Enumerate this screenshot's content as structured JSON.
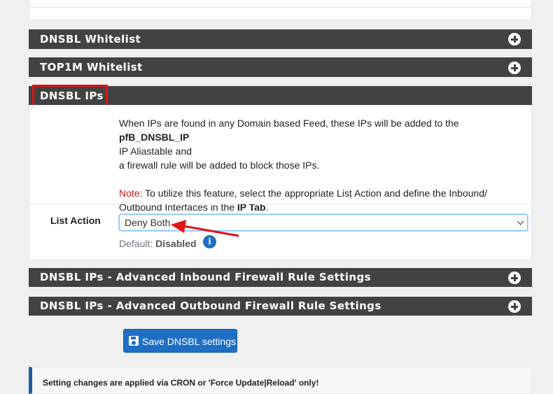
{
  "panels": {
    "dnsbl_whitelist": "DNSBL Whitelist",
    "top1m_whitelist": "TOP1M Whitelist",
    "dnsbl_ips": "DNSBL IPs",
    "adv_inbound": "DNSBL IPs - Advanced Inbound Firewall Rule Settings",
    "adv_outbound": "DNSBL IPs - Advanced Outbound Firewall Rule Settings"
  },
  "description": {
    "line1_pre": "When IPs are found in any Domain based Feed, these IPs will be added to the ",
    "line1_bold": "pfB_DNSBL_IP",
    "line2": "IP Aliastable and",
    "line3": "a firewall rule will be added to block those IPs.",
    "note_label": "Note:",
    "note_text": " To utilize this feature, select the appropriate List Action and define the Inbound/",
    "note_line2_pre": "Outbound Interfaces in the ",
    "note_line2_bold": "IP Tab",
    "note_line2_post": "."
  },
  "list_action": {
    "label": "List Action",
    "selected": "Deny Both",
    "default_label": "Default: ",
    "default_value": "Disabled"
  },
  "save_button": "Save DNSBL settings",
  "alert": "Setting changes are applied via CRON or 'Force Update|Reload' only!",
  "icons": {
    "expand": "plus-circle-icon",
    "info": "info-circle-icon",
    "save": "floppy-disk-icon"
  },
  "colors": {
    "panel_header": "#424242",
    "primary": "#1e6fc4",
    "note": "#c41a16",
    "highlight": "#e21414"
  }
}
